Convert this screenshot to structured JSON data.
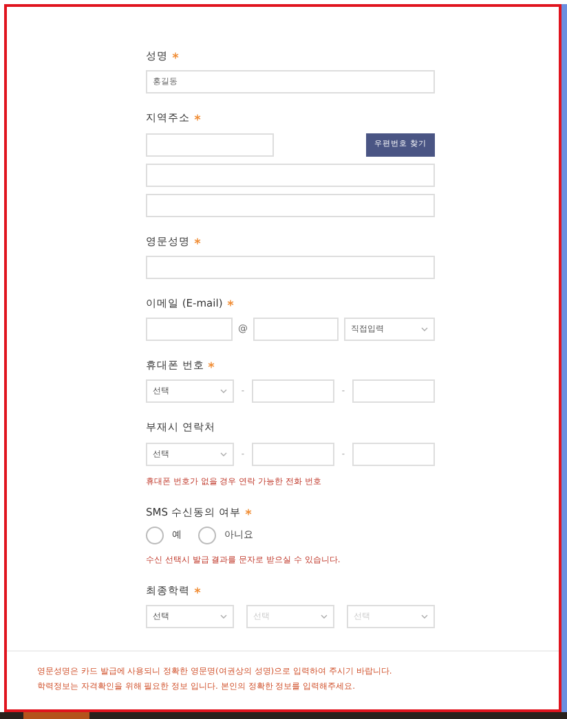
{
  "form": [
    {
      "kind": "text",
      "label": "성명",
      "required": true,
      "value": "홍길동",
      "readonly": true
    },
    {
      "kind": "address",
      "label": "지역주소",
      "required": true,
      "button": "우편번호 찾기"
    },
    {
      "kind": "text",
      "label": "영문성명",
      "required": true,
      "readonly": false
    },
    {
      "kind": "email",
      "label": "이메일 (E-mail)",
      "required": true,
      "at": "@",
      "domain": "직접입력"
    },
    {
      "kind": "phone",
      "label": "휴대폰 번호",
      "required": true,
      "select": "선택",
      "dash": "-"
    },
    {
      "kind": "phone",
      "label": "부재시 연락처",
      "select": "선택",
      "dash": "-",
      "note": "휴대폰 번호가 없을 경우 연락 가능한 전화 번호"
    },
    {
      "kind": "radio",
      "label": "SMS 수신동의 여부",
      "required": true,
      "options": [
        {
          "label": "예",
          "selected": false
        },
        {
          "label": "아니요",
          "selected": false
        }
      ],
      "note": "수신 선택시 발급 결과를 문자로 받으실 수 있습니다."
    },
    {
      "kind": "selects",
      "label": "최종학력",
      "required": true,
      "selects": [
        {
          "text": "선택",
          "disabled": false
        },
        {
          "text": "선택",
          "disabled": true
        },
        {
          "text": "선택",
          "disabled": true
        }
      ]
    }
  ],
  "footer_notes": [
    "영문성명은 카드 발급에 사용되니 정확한 영문명(여권상의 성명)으로 입력하여 주시기 바랍니다.",
    "학력정보는 자격확인을 위해 필요한 정보 입니다. 본인의 정확한 정보를 입력해주세요."
  ]
}
